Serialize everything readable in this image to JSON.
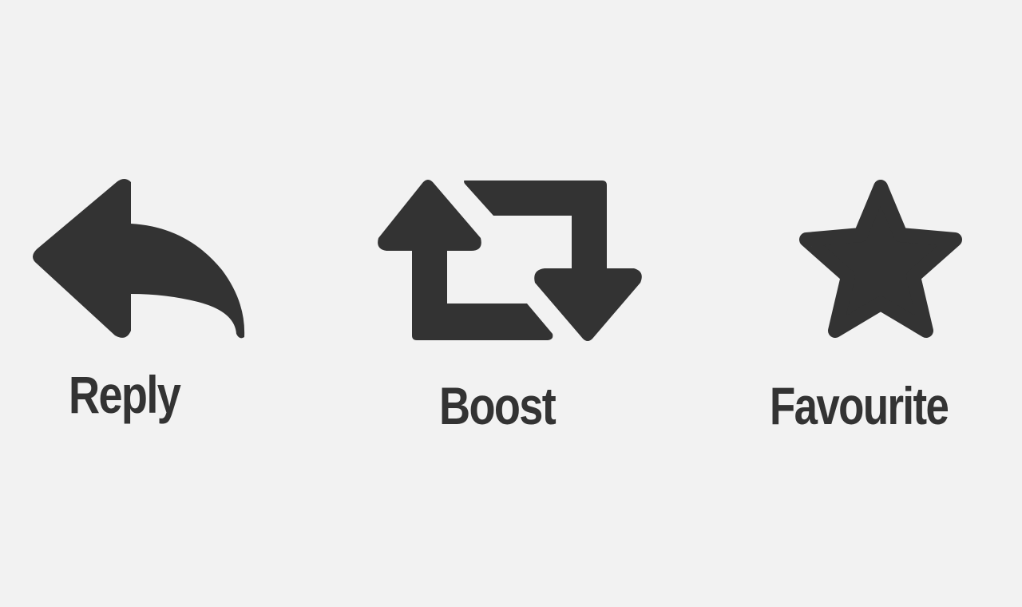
{
  "actions": [
    {
      "id": "reply",
      "label": "Reply",
      "icon": "reply-arrow-icon"
    },
    {
      "id": "boost",
      "label": "Boost",
      "icon": "boost-retweet-icon"
    },
    {
      "id": "favourite",
      "label": "Favourite",
      "icon": "star-icon"
    }
  ],
  "colors": {
    "background": "#f2f2f2",
    "foreground": "#333333"
  }
}
